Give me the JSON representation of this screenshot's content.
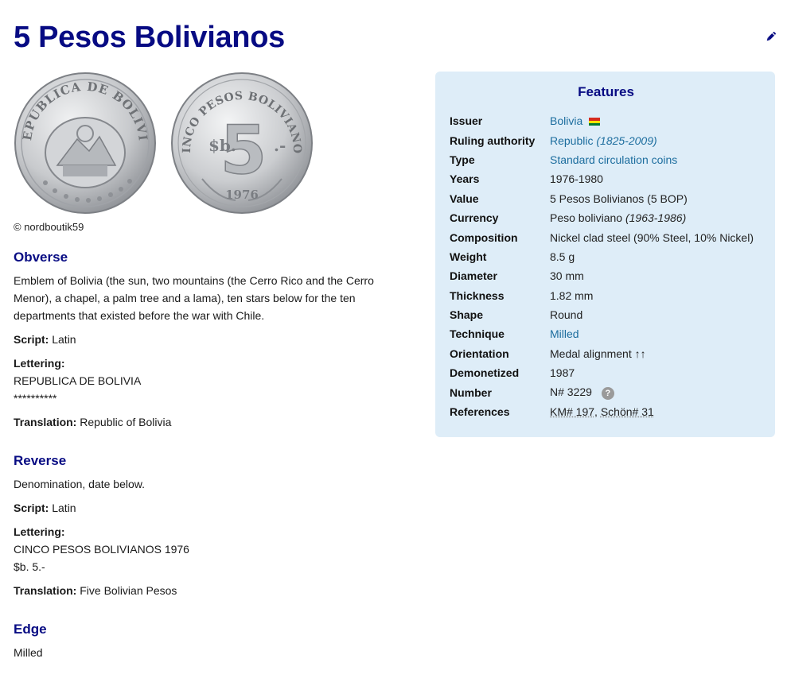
{
  "title": "5 Pesos Bolivianos",
  "edit_icon": "pencil-icon",
  "images": {
    "obverse_alt": "REPUBLICA DE BOLIVIA",
    "reverse_alt": "CINCO PESOS BOLIVIANOS",
    "credit": "© nordboutik59"
  },
  "obverse": {
    "heading": "Obverse",
    "description": "Emblem of Bolivia (the sun, two mountains (the Cerro Rico and the Cerro Menor), a chapel, a palm tree and a lama), ten stars below for the ten departments that existed before the war with Chile.",
    "script_label": "Script:",
    "script_value": "Latin",
    "lettering_label": "Lettering:",
    "lettering_lines": [
      "REPUBLICA DE BOLIVIA",
      "**********"
    ],
    "translation_label": "Translation:",
    "translation_value": "Republic of Bolivia"
  },
  "reverse": {
    "heading": "Reverse",
    "description": "Denomination, date below.",
    "script_label": "Script:",
    "script_value": "Latin",
    "lettering_label": "Lettering:",
    "lettering_lines": [
      "CINCO PESOS BOLIVIANOS 1976",
      "$b. 5.-"
    ],
    "translation_label": "Translation:",
    "translation_value": "Five Bolivian Pesos"
  },
  "edge": {
    "heading": "Edge",
    "value": "Milled"
  },
  "features": {
    "heading": "Features",
    "issuer_key": "Issuer",
    "issuer_value": "Bolivia",
    "flag_colors": [
      "#d52b1e",
      "#f9e300",
      "#007934"
    ],
    "ruling_key": "Ruling authority",
    "ruling_value": "Republic",
    "ruling_period": "(1825-2009)",
    "type_key": "Type",
    "type_value": "Standard circulation coins",
    "years_key": "Years",
    "years_value": "1976-1980",
    "value_key": "Value",
    "value_value": "5 Pesos Bolivianos (5 BOP)",
    "currency_key": "Currency",
    "currency_value": "Peso boliviano",
    "currency_period": "(1963-1986)",
    "composition_key": "Composition",
    "composition_value": "Nickel clad steel (90% Steel, 10% Nickel)",
    "weight_key": "Weight",
    "weight_value": "8.5 g",
    "diameter_key": "Diameter",
    "diameter_value": "30 mm",
    "thickness_key": "Thickness",
    "thickness_value": "1.82 mm",
    "shape_key": "Shape",
    "shape_value": "Round",
    "technique_key": "Technique",
    "technique_value": "Milled",
    "orientation_key": "Orientation",
    "orientation_value": "Medal alignment ↑↑",
    "demonetized_key": "Demonetized",
    "demonetized_value": "1987",
    "number_key": "Number",
    "number_value": "N# 3229",
    "number_help": "?",
    "references_key": "References",
    "references_km": "KM# 197",
    "references_sep": ", ",
    "references_schon": "Schön# 31"
  }
}
